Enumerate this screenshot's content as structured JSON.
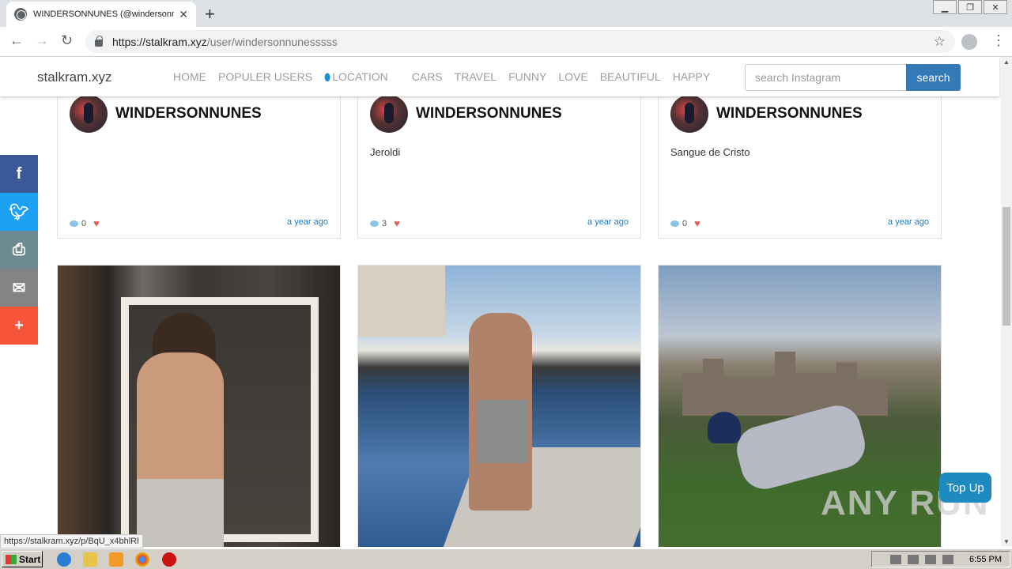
{
  "browser": {
    "tab_title": "WINDERSONNUNES (@windersonnu",
    "url_host": "https://stalkram.xyz",
    "url_path": "/user/windersonnunesssss",
    "status_url": "https://stalkram.xyz/p/BqU_x4bhlRl"
  },
  "site": {
    "brand": "stalkram.xyz",
    "menu": [
      "HOME",
      "POPULER USERS",
      "LOCATION",
      "CARS",
      "TRAVEL",
      "FUNNY",
      "LOVE",
      "BEAUTIFUL",
      "HAPPY"
    ],
    "search_placeholder": "search Instagram",
    "search_button": "search"
  },
  "cards": [
    {
      "username": "WINDERSONNUNES",
      "caption": "",
      "comments": "0",
      "time": "a year ago"
    },
    {
      "username": "WINDERSONNUNES",
      "caption": "Jeroldi",
      "comments": "3",
      "time": "a year ago"
    },
    {
      "username": "WINDERSONNUNES",
      "caption": "Sangue de Cristo",
      "comments": "0",
      "time": "a year ago"
    }
  ],
  "share": {
    "facebook_icon": "f",
    "twitter_icon": "twitter-bird",
    "print_icon": "printer",
    "email_icon": "envelope",
    "more_icon": "+"
  },
  "topup_label": "Top Up",
  "watermark": "ANY RUN",
  "taskbar": {
    "start_label": "Start",
    "clock": "6:55 PM"
  },
  "colors": {
    "search_button": "#337ab7",
    "facebook": "#3b5998",
    "twitter": "#1da1f2",
    "topup": "#1f8ac0"
  }
}
